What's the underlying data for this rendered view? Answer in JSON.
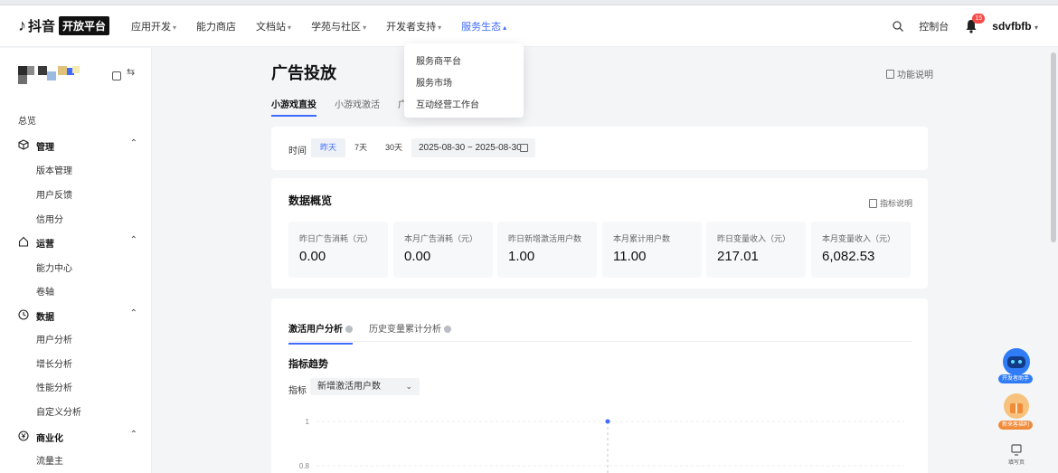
{
  "brand": {
    "glyph": "♪",
    "name": "抖音",
    "badge": "开放平台"
  },
  "nav": {
    "items": [
      {
        "label": "应用开发"
      },
      {
        "label": "能力商店"
      },
      {
        "label": "文档站"
      },
      {
        "label": "学苑与社区"
      },
      {
        "label": "开发者支持"
      },
      {
        "label": "服务生态"
      }
    ],
    "console": "控制台",
    "notification_count": "15",
    "user": "sdvfbfb"
  },
  "dropdown": {
    "items": [
      "服务商平台",
      "服务市场",
      "互动经营工作台"
    ]
  },
  "sidebar": {
    "partial_item": "总览",
    "groups": [
      {
        "label": "管理",
        "items": [
          "版本管理",
          "用户反馈",
          "信用分"
        ]
      },
      {
        "label": "运营",
        "items": [
          "能力中心",
          "卷轴"
        ]
      },
      {
        "label": "数据",
        "items": [
          "用户分析",
          "增长分析",
          "性能分析",
          "自定义分析"
        ]
      },
      {
        "label": "商业化",
        "items": [
          "流量主"
        ]
      }
    ]
  },
  "page": {
    "title": "广告投放",
    "help": "功能说明",
    "tabs": [
      "小游戏直投",
      "小游戏激活",
      "广告"
    ]
  },
  "filter": {
    "time_label": "时间",
    "periods": [
      "昨天",
      "7天",
      "30天"
    ],
    "active_period": "昨天",
    "date_range": "2025-08-30 ~ 2025-08-30"
  },
  "overview": {
    "title": "数据概览",
    "help": "指标说明",
    "metrics": [
      {
        "label": "昨日广告消耗（元）",
        "value": "0.00"
      },
      {
        "label": "本月广告消耗（元）",
        "value": "0.00"
      },
      {
        "label": "昨日新增激活用户数",
        "value": "1.00"
      },
      {
        "label": "本月累计用户数",
        "value": "11.00"
      },
      {
        "label": "昨日变量收入（元）",
        "value": "217.01"
      },
      {
        "label": "本月变量收入（元）",
        "value": "6,082.53"
      }
    ]
  },
  "analysis": {
    "tabs": [
      "激活用户分析",
      "历史变量累计分析"
    ],
    "trend_title": "指标趋势",
    "indicator_label": "指标",
    "indicator_value": "新增激活用户数",
    "y_ticks": [
      "1",
      "0.8"
    ]
  },
  "helpers": {
    "assistant": "开发者助手",
    "benefit": "新来客福利",
    "workbench": "填写页"
  },
  "colors": {
    "accent": "#3f6bff",
    "badge": "#f54a45"
  }
}
